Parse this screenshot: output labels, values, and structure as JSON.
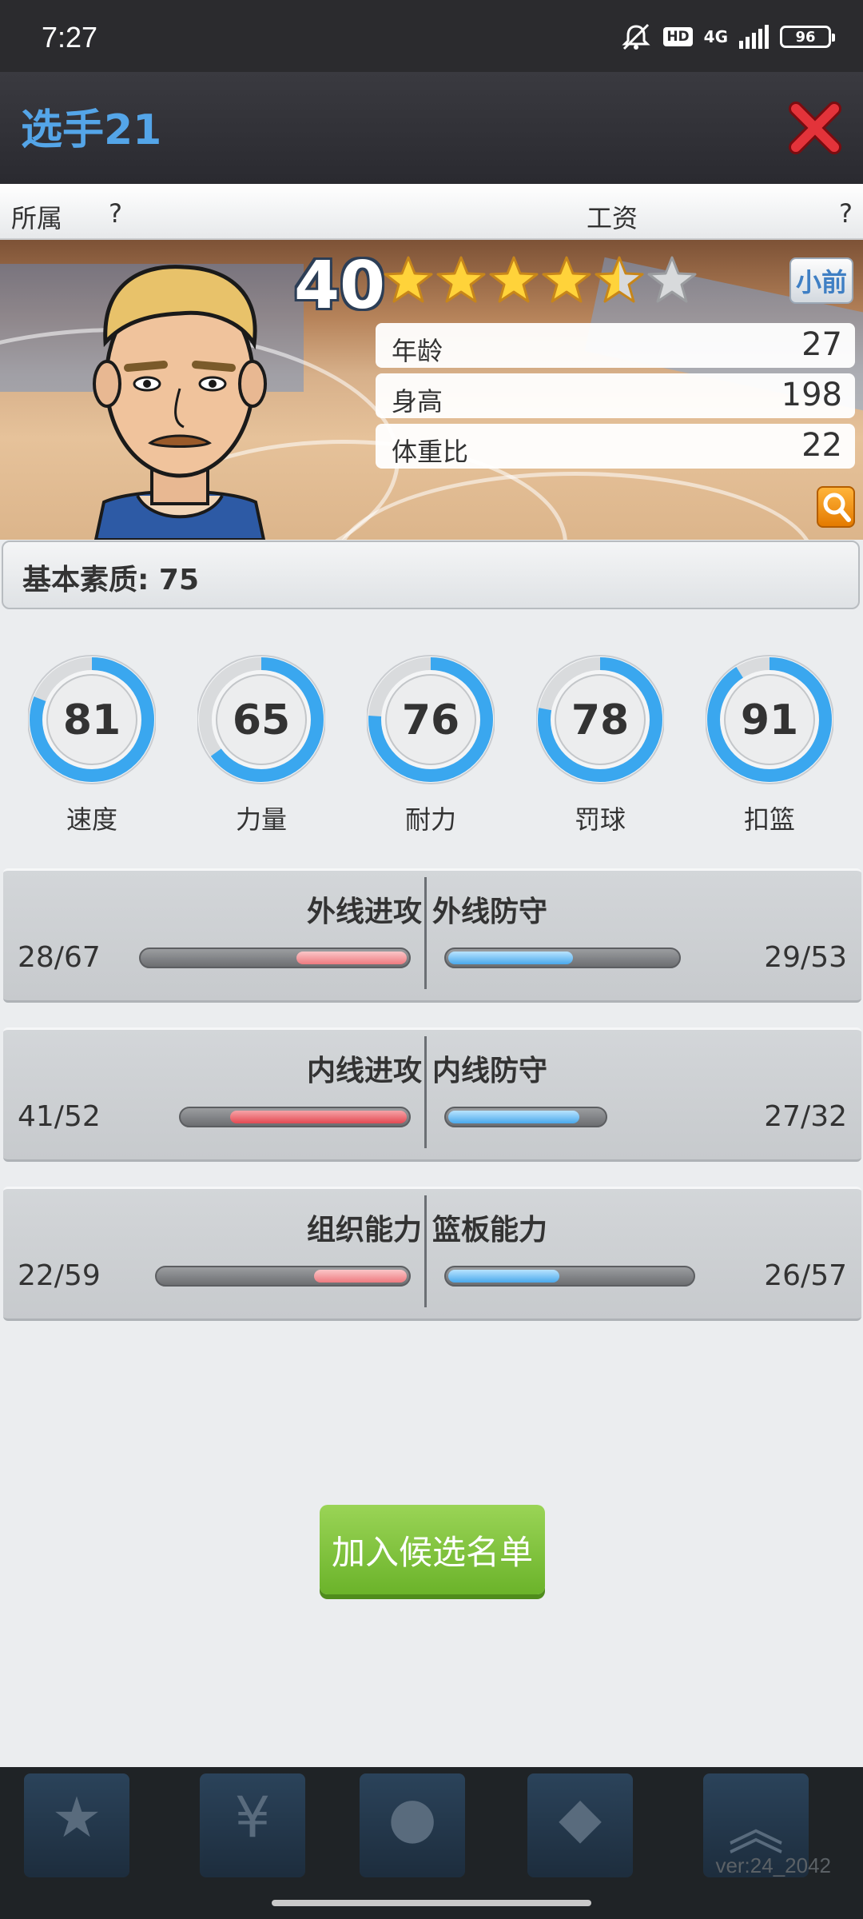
{
  "status_bar": {
    "time": "7:27",
    "hd": "HD",
    "network": "4G",
    "battery": "96"
  },
  "header": {
    "title": "选手21"
  },
  "info_row": {
    "team_label": "所属",
    "team_value": "?",
    "salary_label": "工资",
    "salary_value": "?"
  },
  "player": {
    "rating": "40",
    "stars_filled": 4.5,
    "stars_total": 6,
    "position": "小前",
    "attributes": [
      {
        "label": "年龄",
        "value": "27"
      },
      {
        "label": "身高",
        "value": "198"
      },
      {
        "label": "体重比",
        "value": "22"
      }
    ]
  },
  "base_quality": "基本素质: 75",
  "gauges": [
    {
      "label": "速度",
      "value": "81",
      "ratio": 0.81
    },
    {
      "label": "力量",
      "value": "65",
      "ratio": 0.65
    },
    {
      "label": "耐力",
      "value": "76",
      "ratio": 0.76
    },
    {
      "label": "罚球",
      "value": "78",
      "ratio": 0.78
    },
    {
      "label": "扣篮",
      "value": "91",
      "ratio": 0.91
    }
  ],
  "stat_panels": [
    {
      "left_label": "外线进攻",
      "left_value": "28/67",
      "left_current": 28,
      "left_max": 67,
      "right_label": "外线防守",
      "right_value": "29/53",
      "right_current": 29,
      "right_max": 53
    },
    {
      "left_label": "内线进攻",
      "left_value": "41/52",
      "left_current": 41,
      "left_max": 52,
      "right_label": "内线防守",
      "right_value": "27/32",
      "right_current": 27,
      "right_max": 32
    },
    {
      "left_label": "组织能力",
      "left_value": "22/59",
      "left_current": 22,
      "left_max": 59,
      "right_label": "篮板能力",
      "right_value": "26/57",
      "right_current": 26,
      "right_max": 57
    }
  ],
  "add_button_label": "加入候选名单",
  "version": "ver:24_2042",
  "colors": {
    "accent_blue": "#54a5e8",
    "button_green": "#7cc23a",
    "close_red": "#d8262c",
    "gauge_blue": "#3aa7ef",
    "bar_red": "#e44a53"
  }
}
